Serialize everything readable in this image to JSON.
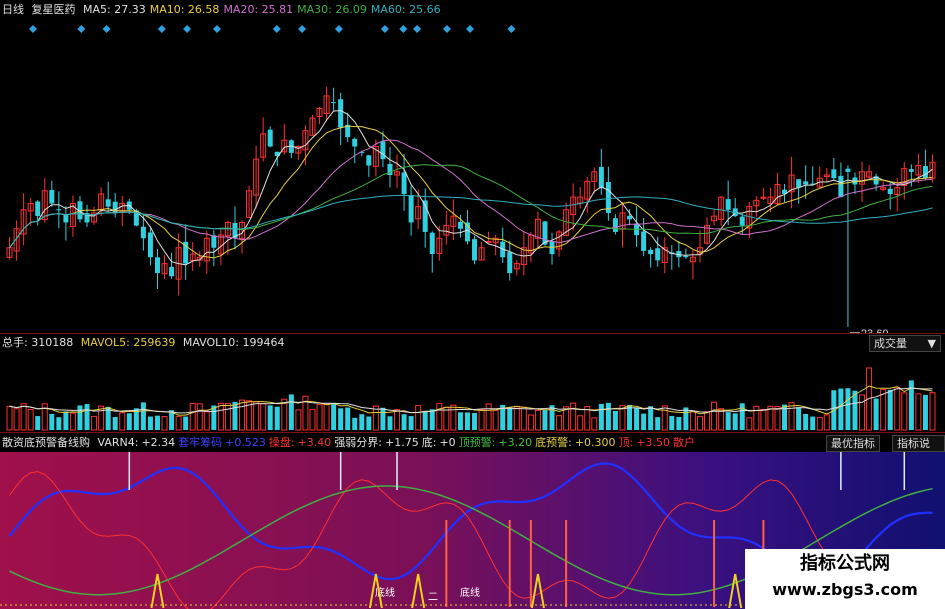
{
  "main_panel": {
    "period": "日线",
    "stock_name": "复星医药",
    "ma": [
      {
        "label": "MA5:",
        "value": "27.33",
        "color": "#e0e0e0"
      },
      {
        "label": "MA10:",
        "value": "26.58",
        "color": "#e8d040"
      },
      {
        "label": "MA20:",
        "value": "25.81",
        "color": "#d070d0"
      },
      {
        "label": "MA30:",
        "value": "26.09",
        "color": "#40b040"
      },
      {
        "label": "MA60:",
        "value": "25.66",
        "color": "#30b0c0"
      }
    ],
    "low_marker": "23.60"
  },
  "volume_panel": {
    "total_label": "总手:",
    "total_value": "310188",
    "mavol5_label": "MAVOL5:",
    "mavol5_value": "259639",
    "mavol10_label": "MAVOL10:",
    "mavol10_value": "199464",
    "dropdown_label": "成交量"
  },
  "indicator_panel": {
    "name": "散资底预警备线购",
    "items": [
      {
        "text": "VARN4:",
        "color": "#e0e0e0"
      },
      {
        "text": "+2.34",
        "color": "#e0e0e0"
      },
      {
        "text": "套牢筹码",
        "color": "#4040ff"
      },
      {
        "text": "+0.523",
        "color": "#4040ff"
      },
      {
        "text": "操盘:",
        "color": "#ff3030"
      },
      {
        "text": "+3.40",
        "color": "#ff3030"
      },
      {
        "text": "强弱分界:",
        "color": "#e0e0e0"
      },
      {
        "text": "+1.75",
        "color": "#e0e0e0"
      },
      {
        "text": "底:",
        "color": "#e0e0e0"
      },
      {
        "text": "+0",
        "color": "#e0e0e0"
      },
      {
        "text": "顶预警:",
        "color": "#40c040"
      },
      {
        "text": "+3.20",
        "color": "#40c040"
      },
      {
        "text": "底预警:",
        "color": "#e8d040"
      },
      {
        "text": "+0.300",
        "color": "#e8d040"
      },
      {
        "text": "顶:",
        "color": "#ff3030"
      },
      {
        "text": "+3.50",
        "color": "#ff3030"
      },
      {
        "text": "散户",
        "color": "#ff3030"
      }
    ],
    "btn_best": "最优指标",
    "btn_help": "指标说明",
    "marks": [
      "底线",
      "二",
      "底线"
    ]
  },
  "watermark": {
    "line1": "指标公式网",
    "line2": "www.zbgs3.com"
  },
  "chart_data": {
    "type": "candlestick",
    "title": "复星医药",
    "ylim": [
      22,
      31.8
    ],
    "x": "trading days (132 candles)",
    "closes": [
      24.6,
      25.2,
      25.8,
      26.0,
      25.6,
      26.4,
      26.0,
      25.8,
      25.4,
      26.0,
      25.5,
      25.4,
      25.7,
      26.3,
      25.9,
      25.7,
      26.0,
      25.8,
      25.3,
      24.9,
      24.3,
      23.8,
      24.1,
      23.7,
      24.6,
      24.1,
      24.4,
      24.3,
      24.9,
      24.6,
      25.0,
      25.4,
      24.9,
      25.4,
      26.4,
      27.4,
      28.2,
      27.8,
      27.5,
      28.0,
      27.6,
      27.8,
      28.3,
      28.7,
      29.0,
      29.4,
      29.2,
      28.4,
      28.1,
      27.8,
      27.6,
      27.2,
      27.8,
      27.4,
      26.9,
      27.0,
      26.3,
      25.4,
      25.9,
      25.1,
      24.4,
      24.9,
      25.3,
      25.6,
      25.2,
      24.8,
      24.2,
      24.6,
      24.8,
      24.9,
      24.3,
      23.8,
      24.1,
      24.6,
      25.0,
      25.5,
      24.7,
      24.4,
      25.1,
      25.8,
      26.2,
      26.2,
      26.7,
      27.0,
      26.5,
      25.7,
      25.1,
      25.7,
      25.5,
      25.0,
      24.5,
      24.4,
      24.2,
      24.6,
      24.4,
      24.3,
      24.3,
      24.3,
      24.6,
      25.3,
      25.6,
      26.2,
      25.8,
      25.6,
      25.3,
      25.9,
      26.1,
      26.2,
      26.2,
      26.6,
      26.3,
      26.9,
      26.5,
      26.6,
      26.6,
      26.8,
      26.9,
      26.8,
      26.2,
      27.0,
      26.6,
      27.0,
      27.0,
      26.6,
      26.5,
      26.3,
      26.5,
      27.1,
      27.0,
      27.2,
      26.8,
      27.3
    ],
    "volume_ylim": [
      0,
      400000
    ],
    "volume_last": 310188,
    "indicator_series": [
      "VARN4",
      "套牢筹码",
      "操盘",
      "强弱分界",
      "顶预警",
      "底预警"
    ]
  }
}
